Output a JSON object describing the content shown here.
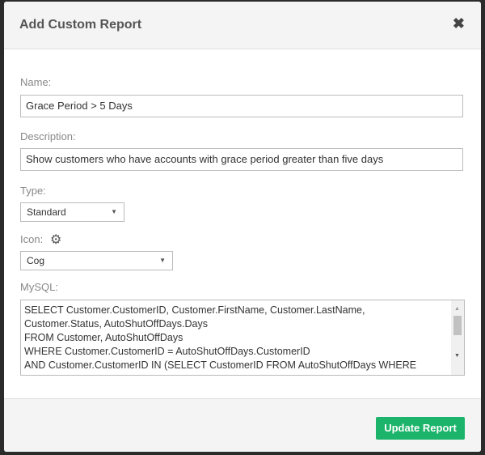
{
  "dialog": {
    "title": "Add Custom Report",
    "close_icon": "close-icon"
  },
  "form": {
    "name_label": "Name:",
    "name_value": "Grace Period > 5 Days",
    "description_label": "Description:",
    "description_value": "Show customers who have accounts with grace period greater than five days",
    "type_label": "Type:",
    "type_value": "Standard",
    "icon_label": "Icon:",
    "icon_value": "Cog",
    "icon_preview": "gear-icon",
    "mysql_label": "MySQL:",
    "mysql_lines": [
      "SELECT Customer.CustomerID, Customer.FirstName, Customer.LastName,",
      "Customer.Status, AutoShutOffDays.Days",
      "FROM Customer, AutoShutOffDays",
      "WHERE Customer.CustomerID = AutoShutOffDays.CustomerID",
      "AND Customer.CustomerID IN (SELECT CustomerID FROM AutoShutOffDays WHERE"
    ]
  },
  "footer": {
    "submit_label": "Update Report",
    "accent": "#1cb46a"
  }
}
